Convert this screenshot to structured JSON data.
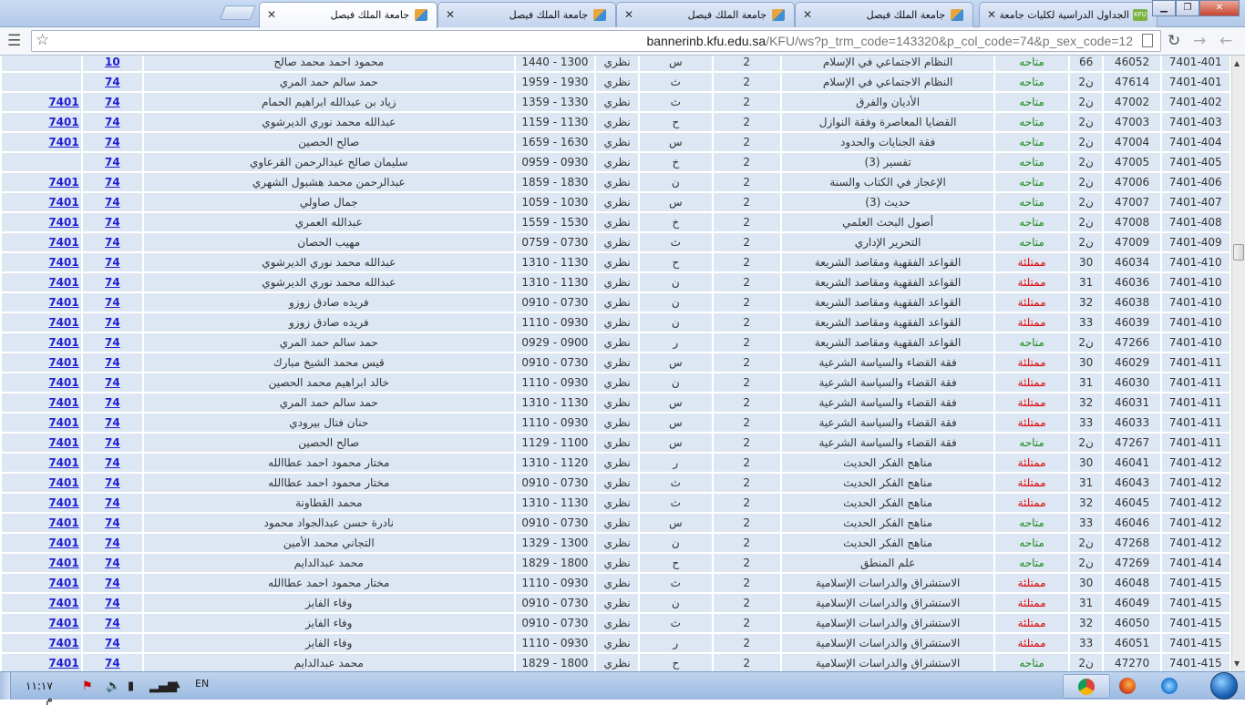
{
  "browser": {
    "tabs": [
      {
        "title": "الجداول الدراسية لكليات جامعة",
        "favicon": "kfu-icon"
      },
      {
        "title": "جامعة الملك فيصل",
        "favicon": "kfu-logo-icon"
      },
      {
        "title": "جامعة الملك فيصل",
        "favicon": "kfu-logo-icon"
      },
      {
        "title": "جامعة الملك فيصل",
        "favicon": "kfu-logo-icon"
      },
      {
        "title": "جامعة الملك فيصل",
        "favicon": "kfu-logo-icon"
      }
    ],
    "url_host": "bannerinb.kfu.edu.sa",
    "url_path": "/KFU/ws?p_trm_code=143320&p_col_code=74&p_sex_code=12"
  },
  "table": {
    "rows": [
      [
        "7401-401",
        "46052",
        "66",
        "متاحه",
        "النظام الاجتماعي في الإسلام",
        "2",
        "س",
        "نظري",
        "1300 - 1440",
        "محمود احمد محمد صالح",
        "10",
        ""
      ],
      [
        "7401-401",
        "47614",
        "ن2",
        "متاحه",
        "النظام الاجتماعي في الإسلام",
        "2",
        "ث",
        "نظري",
        "1930 - 1959",
        "حمد سالم حمد المري",
        "74",
        ""
      ],
      [
        "7401-402",
        "47002",
        "ن2",
        "متاحه",
        "الأديان والفرق",
        "2",
        "ث",
        "نظري",
        "1330 - 1359",
        "زياد بن عبدالله ابراهيم الحمام",
        "74",
        "7401"
      ],
      [
        "7401-403",
        "47003",
        "ن2",
        "متاحه",
        "القضايا المعاصرة وفقة النوازل",
        "2",
        "ح",
        "نظري",
        "1130 - 1159",
        "عبدالله محمد نوري الديرشوي",
        "74",
        "7401"
      ],
      [
        "7401-404",
        "47004",
        "ن2",
        "متاحه",
        "فقة الجنايات والحدود",
        "2",
        "س",
        "نظري",
        "1630 - 1659",
        "صالح الحصين",
        "74",
        "7401"
      ],
      [
        "7401-405",
        "47005",
        "ن2",
        "متاحه",
        "تفسير (3)",
        "2",
        "خ",
        "نظري",
        "0930 - 0959",
        "سليمان صالح عبدالرحمن القرعاوي",
        "74",
        ""
      ],
      [
        "7401-406",
        "47006",
        "ن2",
        "متاحه",
        "الإعجاز في الكتاب والسنة",
        "2",
        "ن",
        "نظري",
        "1830 - 1859",
        "عبدالرحمن محمد هشبول الشهري",
        "74",
        "7401"
      ],
      [
        "7401-407",
        "47007",
        "ن2",
        "متاحه",
        "حديث (3)",
        "2",
        "س",
        "نظري",
        "1030 - 1059",
        "جمال صاولي",
        "74",
        "7401"
      ],
      [
        "7401-408",
        "47008",
        "ن2",
        "متاحه",
        "أصول البحث العلمي",
        "2",
        "خ",
        "نظري",
        "1530 - 1559",
        "عبدالله العمري",
        "74",
        "7401"
      ],
      [
        "7401-409",
        "47009",
        "ن2",
        "متاحه",
        "التحرير الإداري",
        "2",
        "ث",
        "نظري",
        "0730 - 0759",
        "مهيب الحصان",
        "74",
        "7401"
      ],
      [
        "7401-410",
        "46034",
        "30",
        "ممتلئة",
        "القواعد الفقهية ومقاصد الشريعة",
        "2",
        "ح",
        "نظري",
        "1130 - 1310",
        "عبدالله محمد نوري الديرشوي",
        "74",
        "7401"
      ],
      [
        "7401-410",
        "46036",
        "31",
        "ممتلئة",
        "القواعد الفقهية ومقاصد الشريعة",
        "2",
        "ن",
        "نظري",
        "1130 - 1310",
        "عبدالله محمد نوري الديرشوي",
        "74",
        "7401"
      ],
      [
        "7401-410",
        "46038",
        "32",
        "ممتلئة",
        "القواعد الفقهية ومقاصد الشريعة",
        "2",
        "ن",
        "نظري",
        "0730 - 0910",
        "فريده صادق زوزو",
        "74",
        "7401"
      ],
      [
        "7401-410",
        "46039",
        "33",
        "ممتلئة",
        "القواعد الفقهية ومقاصد الشريعة",
        "2",
        "ن",
        "نظري",
        "0930 - 1110",
        "فريده صادق زوزو",
        "74",
        "7401"
      ],
      [
        "7401-410",
        "47266",
        "ن2",
        "متاحه",
        "القواعد الفقهية ومقاصد الشريعة",
        "2",
        "ر",
        "نظري",
        "0900 - 0929",
        "حمد سالم حمد المري",
        "74",
        "7401"
      ],
      [
        "7401-411",
        "46029",
        "30",
        "ممتلئة",
        "فقة القضاء والسياسة الشرعية",
        "2",
        "س",
        "نظري",
        "0730 - 0910",
        "قيس محمد الشيخ مبارك",
        "74",
        "7401"
      ],
      [
        "7401-411",
        "46030",
        "31",
        "ممتلئة",
        "فقة القضاء والسياسة الشرعية",
        "2",
        "ن",
        "نظري",
        "0930 - 1110",
        "خالد ابراهيم محمد الحصين",
        "74",
        "7401"
      ],
      [
        "7401-411",
        "46031",
        "32",
        "ممتلئة",
        "فقة القضاء والسياسة الشرعية",
        "2",
        "س",
        "نظري",
        "1130 - 1310",
        "حمد سالم حمد المري",
        "74",
        "7401"
      ],
      [
        "7401-411",
        "46033",
        "33",
        "ممتلئة",
        "فقة القضاء والسياسة الشرعية",
        "2",
        "س",
        "نظري",
        "0930 - 1110",
        "حنان فتال بيرودي",
        "74",
        "7401"
      ],
      [
        "7401-411",
        "47267",
        "ن2",
        "متاحه",
        "فقة القضاء والسياسة الشرعية",
        "2",
        "س",
        "نظري",
        "1100 - 1129",
        "صالح الحصين",
        "74",
        "7401"
      ],
      [
        "7401-412",
        "46041",
        "30",
        "ممتلئة",
        "مناهج الفكر الحديث",
        "2",
        "ر",
        "نظري",
        "1120 - 1310",
        "مختار محمود احمد عطاالله",
        "74",
        "7401"
      ],
      [
        "7401-412",
        "46043",
        "31",
        "ممتلئة",
        "مناهج الفكر الحديث",
        "2",
        "ث",
        "نظري",
        "0730 - 0910",
        "مختار محمود احمد عطاالله",
        "74",
        "7401"
      ],
      [
        "7401-412",
        "46045",
        "32",
        "ممتلئة",
        "مناهج الفكر الحديث",
        "2",
        "ث",
        "نظري",
        "1130 - 1310",
        "محمد القطاونة",
        "74",
        "7401"
      ],
      [
        "7401-412",
        "46046",
        "33",
        "متاحه",
        "مناهج الفكر الحديث",
        "2",
        "س",
        "نظري",
        "0730 - 0910",
        "نادرة حسن عبدالجواد محمود",
        "74",
        "7401"
      ],
      [
        "7401-412",
        "47268",
        "ن2",
        "متاحه",
        "مناهج الفكر الحديث",
        "2",
        "ن",
        "نظري",
        "1300 - 1329",
        "التجاني محمد الأمين",
        "74",
        "7401"
      ],
      [
        "7401-414",
        "47269",
        "ن2",
        "متاحه",
        "علم المنطق",
        "2",
        "ح",
        "نظري",
        "1800 - 1829",
        "محمد عبدالدايم",
        "74",
        "7401"
      ],
      [
        "7401-415",
        "46048",
        "30",
        "ممتلئة",
        "الاستشراق والدراسات الإسلامية",
        "2",
        "ث",
        "نظري",
        "0930 - 1110",
        "مختار محمود احمد عطاالله",
        "74",
        "7401"
      ],
      [
        "7401-415",
        "46049",
        "31",
        "ممتلئة",
        "الاستشراق والدراسات الإسلامية",
        "2",
        "ن",
        "نظري",
        "0730 - 0910",
        "وفاء الفايز",
        "74",
        "7401"
      ],
      [
        "7401-415",
        "46050",
        "32",
        "ممتلئة",
        "الاستشراق والدراسات الإسلامية",
        "2",
        "ث",
        "نظري",
        "0730 - 0910",
        "وفاء الفايز",
        "74",
        "7401"
      ],
      [
        "7401-415",
        "46051",
        "33",
        "ممتلئة",
        "الاستشراق والدراسات الإسلامية",
        "2",
        "ر",
        "نظري",
        "0930 - 1110",
        "وفاء الفايز",
        "74",
        "7401"
      ],
      [
        "7401-415",
        "47270",
        "ن2",
        "متاحه",
        "الاستشراق والدراسات الإسلامية",
        "2",
        "ح",
        "نظري",
        "1800 - 1829",
        "محمد عبدالدايم",
        "74",
        "7401"
      ]
    ]
  },
  "taskbar": {
    "clock": "١١:١٧ م",
    "lang": "EN",
    "apps": [
      "chrome-icon",
      "firefox-icon",
      "ie-icon"
    ]
  },
  "colors": {
    "available": "#1a8b1a",
    "full": "#e00000",
    "link": "#1f1fd1",
    "row_bg": "#dde7f4"
  }
}
